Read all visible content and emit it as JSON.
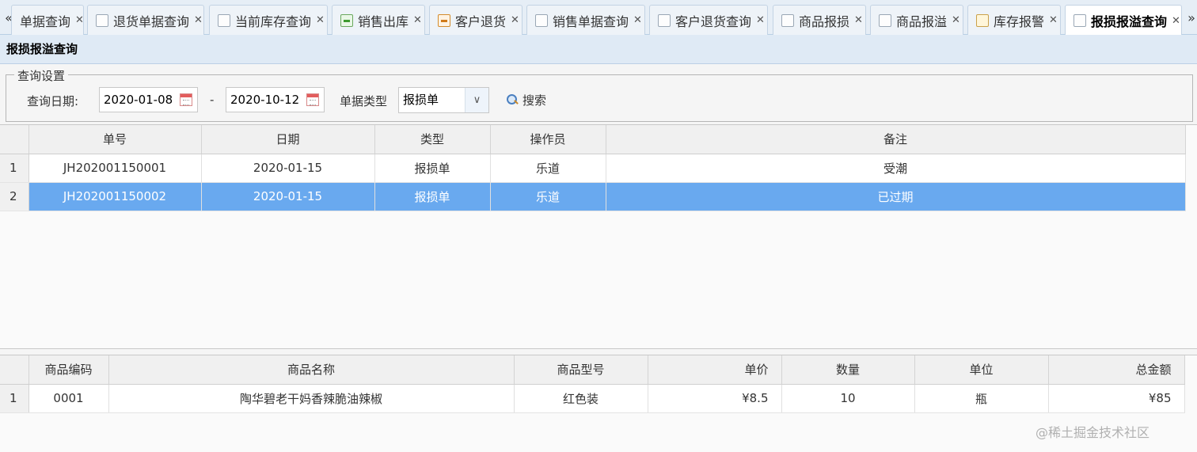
{
  "tabbar": {
    "scroll_left": "«",
    "scroll_right": "»",
    "close_glyph": "✕",
    "tabs": [
      {
        "label": "单据查询",
        "icon": "none"
      },
      {
        "label": "退货单据查询",
        "icon": "document-icon"
      },
      {
        "label": "当前库存查询",
        "icon": "database-icon"
      },
      {
        "label": "销售出库",
        "icon": "export-arrow-icon"
      },
      {
        "label": "客户退货",
        "icon": "import-arrow-icon"
      },
      {
        "label": "销售单据查询",
        "icon": "document-icon"
      },
      {
        "label": "客户退货查询",
        "icon": "document-icon"
      },
      {
        "label": "商品报损",
        "icon": "document-minus-icon"
      },
      {
        "label": "商品报溢",
        "icon": "document-plus-icon"
      },
      {
        "label": "库存报警",
        "icon": "warning-icon"
      },
      {
        "label": "报损报溢查询",
        "icon": "document-icon",
        "active": true
      }
    ]
  },
  "panel": {
    "title": "报损报溢查询"
  },
  "query": {
    "legend": "查询设置",
    "date_label": "查询日期:",
    "start_date": "2020-01-08",
    "separator": "-",
    "end_date": "2020-10-12",
    "type_label": "单据类型",
    "type_value": "报损单",
    "search_label": "搜索"
  },
  "upper_grid": {
    "columns": [
      "单号",
      "日期",
      "类型",
      "操作员",
      "备注"
    ],
    "rows": [
      {
        "num": "1",
        "cells": [
          "JH202001150001",
          "2020-01-15",
          "报损单",
          "乐道",
          "受潮"
        ]
      },
      {
        "num": "2",
        "cells": [
          "JH202001150002",
          "2020-01-15",
          "报损单",
          "乐道",
          "已过期"
        ],
        "selected": true
      }
    ]
  },
  "lower_grid": {
    "columns": [
      "商品编码",
      "商品名称",
      "商品型号",
      "单价",
      "数量",
      "单位",
      "总金额"
    ],
    "rows": [
      {
        "num": "1",
        "cells": [
          "0001",
          "陶华碧老干妈香辣脆油辣椒",
          "红色装",
          "¥8.5",
          "10",
          "瓶",
          "¥85"
        ]
      }
    ]
  },
  "watermark": "@稀土掘金技术社区",
  "colors": {
    "selected_row": "#69a9ef",
    "panel_header": "#dfeaf5",
    "tabbar_bg": "#e6eef6"
  }
}
